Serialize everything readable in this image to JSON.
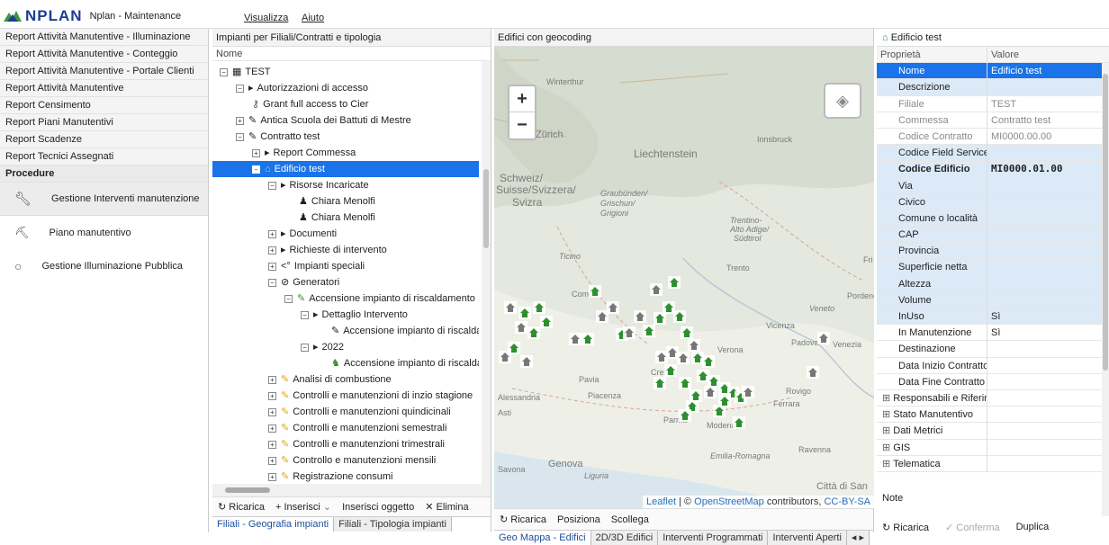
{
  "app": {
    "logo_text": "NPLAN",
    "title": "Nplan - Maintenance",
    "menu": [
      "Visualizza",
      "Aiuto"
    ]
  },
  "left": {
    "reports": [
      "Report Attività Manutentive - Illuminazione",
      "Report Attività Manutentive - Conteggio",
      "Report Attività Manutentive - Portale Clienti",
      "Report Attività Manutentive",
      "Report Censimento",
      "Report Piani Manutentivi",
      "Report Scadenze",
      "Report Tecnici Assegnati"
    ],
    "section": "Procedure",
    "procedures": [
      "Gestione Interventi manutenzione",
      "Piano manutentivo",
      "Gestione Illuminazione Pubblica"
    ]
  },
  "tree": {
    "header": "Impianti per Filiali/Contratti e tipologia",
    "column": "Nome",
    "rows": [
      {
        "label": "TEST"
      },
      {
        "label": "Autorizzazioni di accesso"
      },
      {
        "label": "Grant full access to Cier"
      },
      {
        "label": "Antica Scuola dei Battuti di Mestre"
      },
      {
        "label": "Contratto test"
      },
      {
        "label": "Report Commessa"
      },
      {
        "label": "Edificio test"
      },
      {
        "label": "Risorse Incaricate"
      },
      {
        "label": "Chiara Menolfi"
      },
      {
        "label": "Chiara Menolfi"
      },
      {
        "label": "Documenti"
      },
      {
        "label": "Richieste di intervento"
      },
      {
        "label": "Impianti speciali"
      },
      {
        "label": "Generatori"
      },
      {
        "label": "Accensione impianto di riscaldamento"
      },
      {
        "label": "Dettaglio Intervento"
      },
      {
        "label": "Accensione impianto di riscaldam"
      },
      {
        "label": "2022"
      },
      {
        "label": "Accensione impianto di riscaldam"
      },
      {
        "label": "Analisi di combustione"
      },
      {
        "label": "Controlli e manutenzioni di inzio stagione"
      },
      {
        "label": "Controlli e manutenzioni quindicinali"
      },
      {
        "label": "Controlli e manutenzioni semestrali"
      },
      {
        "label": "Controlli e manutenzioni trimestrali"
      },
      {
        "label": "Controllo e manutenzioni mensili"
      },
      {
        "label": "Registrazione consumi"
      }
    ],
    "toolbar": {
      "reload": "Ricarica",
      "insert": "Inserisci",
      "insert_object": "Inserisci oggetto",
      "delete": "Elimina"
    },
    "tabs": [
      "Filiali - Geografia impianti",
      "Filiali - Tipologia impianti"
    ]
  },
  "map": {
    "header": "Edifici con geocoding",
    "attribution_leaflet": "Leaflet",
    "attribution_sep": " | © ",
    "attribution_osm": "OpenStreetMap",
    "attribution_mid": " contributors, ",
    "attribution_license": "CC-BY-SA",
    "cities": [
      "Winterthur",
      "Zürich",
      "Liechtenstein",
      "Schweiz/",
      "Suisse/Svizzera/",
      "Svizra",
      "Innsbruck",
      "Graubünden/",
      "Grischun/",
      "Grigioni",
      "Trentino-",
      "Alto Adige/",
      "Südtirol",
      "Ticino",
      "Trento",
      "Como",
      "Vicenza",
      "Padova",
      "Venezia",
      "Verona",
      "Pavia",
      "Alessandria",
      "Piacenza",
      "Asti",
      "Parma",
      "Modena",
      "Rovigo",
      "Ferrara",
      "Emilia-Romagna",
      "Ravenna",
      "Genova",
      "Liguria",
      "Savona",
      "Città di San",
      "Pordenon",
      "Veneto",
      "Fri",
      "Cren"
    ],
    "toolbar": {
      "reload": "Ricarica",
      "position": "Posiziona",
      "unlink": "Scollega"
    },
    "tabs": [
      "Geo Mappa - Edifici",
      "2D/3D Edifici",
      "Interventi Programmati",
      "Interventi Aperti"
    ]
  },
  "props": {
    "title": "Edificio test",
    "col_property": "Proprietà",
    "col_value": "Valore",
    "rows": [
      {
        "k": "Nome",
        "v": "Edificio test"
      },
      {
        "k": "Descrizione",
        "v": ""
      },
      {
        "k": "Filiale",
        "v": "TEST"
      },
      {
        "k": "Commessa",
        "v": "Contratto test"
      },
      {
        "k": "Codice Contratto",
        "v": "MI0000.00.00"
      },
      {
        "k": "Codice Field Service",
        "v": ""
      },
      {
        "k": "Codice Edificio",
        "v": "MI0000.01.00"
      },
      {
        "k": "Via",
        "v": ""
      },
      {
        "k": "Civico",
        "v": ""
      },
      {
        "k": "Comune o località",
        "v": ""
      },
      {
        "k": "CAP",
        "v": ""
      },
      {
        "k": "Provincia",
        "v": ""
      },
      {
        "k": "Superficie netta",
        "v": ""
      },
      {
        "k": "Altezza",
        "v": ""
      },
      {
        "k": "Volume",
        "v": ""
      },
      {
        "k": "InUso",
        "v": "Sì"
      },
      {
        "k": "In Manutenzione",
        "v": "Sì"
      },
      {
        "k": "Destinazione",
        "v": ""
      },
      {
        "k": "Data Inizio Contratto",
        "v": ""
      },
      {
        "k": "Data Fine Contratto",
        "v": ""
      },
      {
        "k": "Responsabili e Riferim",
        "v": ""
      },
      {
        "k": "Stato Manutentivo",
        "v": ""
      },
      {
        "k": "Dati Metrici",
        "v": ""
      },
      {
        "k": "GIS",
        "v": ""
      },
      {
        "k": "Telematica",
        "v": ""
      }
    ],
    "note_label": "Note",
    "toolbar": {
      "reload": "Ricarica",
      "confirm": "Conferma",
      "duplicate": "Duplica"
    }
  }
}
